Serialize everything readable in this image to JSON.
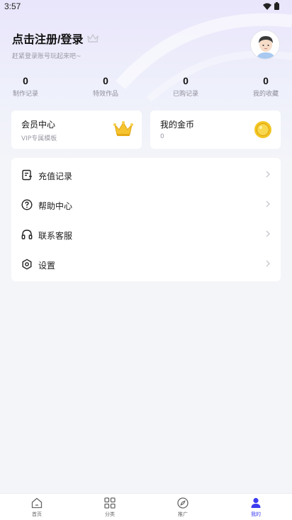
{
  "status_bar": {
    "time": "3:57"
  },
  "header": {
    "title": "点击注册/登录",
    "subtitle": "赶紧登录账号玩起来吧~"
  },
  "stats": [
    {
      "value": "0",
      "label": "制作记录"
    },
    {
      "value": "0",
      "label": "特效作品"
    },
    {
      "value": "0",
      "label": "已购记录"
    },
    {
      "value": "0",
      "label": "我的收藏"
    }
  ],
  "cards": {
    "vip": {
      "title": "会员中心",
      "subtitle": "VIP专属模板"
    },
    "coins": {
      "title": "我的金币",
      "value": "0"
    }
  },
  "menu": [
    {
      "label": "充值记录",
      "icon": "receipt-icon"
    },
    {
      "label": "帮助中心",
      "icon": "question-icon"
    },
    {
      "label": "联系客服",
      "icon": "headset-icon"
    },
    {
      "label": "设置",
      "icon": "settings-icon"
    }
  ],
  "bottom_nav": [
    {
      "label": "首页",
      "icon": "home-icon",
      "active": false
    },
    {
      "label": "分类",
      "icon": "grid-icon",
      "active": false
    },
    {
      "label": "推广",
      "icon": "compass-icon",
      "active": false
    },
    {
      "label": "我的",
      "icon": "user-icon",
      "active": true
    }
  ],
  "colors": {
    "accent": "#3d3df0",
    "background": "#f4f5f9",
    "card": "#ffffff",
    "gold": "#f3c623"
  }
}
